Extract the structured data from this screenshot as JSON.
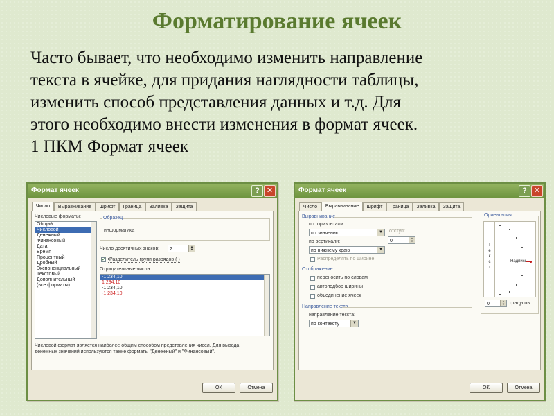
{
  "slide": {
    "title": "Форматирование ячеек",
    "text_lines": [
      "Часто бывает, что необходимо изменить направление",
      "текста в ячейке, для придания наглядности таблицы,",
      "изменить способ представления данных и т.д. Для",
      "этого необходимо внести изменения в формат ячеек.",
      "1 ПКМ  Формат ячеек"
    ]
  },
  "dialog_common": {
    "title": "Формат ячеек",
    "help": "?",
    "close": "✕",
    "tabs": [
      "Число",
      "Выравнивание",
      "Шрифт",
      "Граница",
      "Заливка",
      "Защита"
    ],
    "ok": "OK",
    "cancel": "Отмена"
  },
  "dialog1": {
    "active_tab": "Число",
    "formats_label": "Числовые форматы:",
    "formats": [
      "Общий",
      "Числовой",
      "Денежный",
      "Финансовый",
      "Дата",
      "Время",
      "Процентный",
      "Дробный",
      "Экспоненциальный",
      "Текстовый",
      "Дополнительный",
      "(все форматы)"
    ],
    "selected_format": "Числовой",
    "sample_label": "Образец",
    "sample_value": "информатика",
    "decimals_label": "Число десятичных знаков:",
    "decimals_value": "2",
    "separator_label": "Разделитель групп разрядов ( )",
    "separator_checked": true,
    "negative_label": "Отрицательные числа:",
    "negative_options": [
      {
        "text": "-1 234,10",
        "red": false,
        "selected": true
      },
      {
        "text": "1 234,10",
        "red": true,
        "selected": false
      },
      {
        "text": "-1 234,10",
        "red": false,
        "selected": false
      },
      {
        "text": "-1 234,10",
        "red": true,
        "selected": false
      }
    ],
    "description_lines": [
      "Числовой формат является наиболее общим способом представления чисел. Для вывода",
      "денежных значений используются также форматы \"Денежный\" и \"Финансовый\"."
    ]
  },
  "dialog2": {
    "active_tab": "Выравнивание",
    "alignment_heading": "Выравнивание",
    "horizontal_label": "по горизонтали:",
    "horizontal_value": "по значению",
    "indent_label": "отступ:",
    "indent_value": "0",
    "vertical_label": "по вертикали:",
    "vertical_value": "по нижнему краю",
    "distribute_label": "Распределять по ширине",
    "display_heading": "Отображение",
    "wrap_label": "переносить по словам",
    "autofit_label": "автоподбор ширины",
    "merge_label": "объединение ячеек",
    "direction_heading": "Направление текста",
    "direction_label": "направление текста:",
    "direction_value": "по контексту",
    "orientation_heading": "Ориентация",
    "vertical_text": [
      "Т",
      "е",
      "к",
      "с",
      "т"
    ],
    "inscription": "Надпись",
    "degrees_value": "0",
    "degrees_label": "градусов"
  }
}
